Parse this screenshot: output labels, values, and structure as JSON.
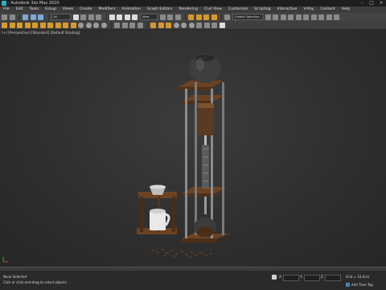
{
  "window": {
    "title": "- Autodesk 3ds Max 2020"
  },
  "menu": [
    "File",
    "Edit",
    "Tools",
    "Group",
    "Views",
    "Create",
    "Modifiers",
    "Animation",
    "Graph Editors",
    "Rendering",
    "Civil View",
    "Customize",
    "Scripting",
    "Interactive",
    "V-Ray",
    "Content",
    "Help"
  ],
  "toolbar": {
    "selection_filter": "All",
    "coord_system": "View",
    "named_selection": "Create Selection Se"
  },
  "viewport": {
    "label": "[+] [Perspective] [Standard] [Default Shading]"
  },
  "status": {
    "selection": "None Selected",
    "prompt": "Click or click-and-drag to select objects",
    "x_label": "X:",
    "y_label": "Y:",
    "z_label": "Z:",
    "grid": "Grid = 10,0cm",
    "add_time_tag": "Add Time Tag"
  }
}
